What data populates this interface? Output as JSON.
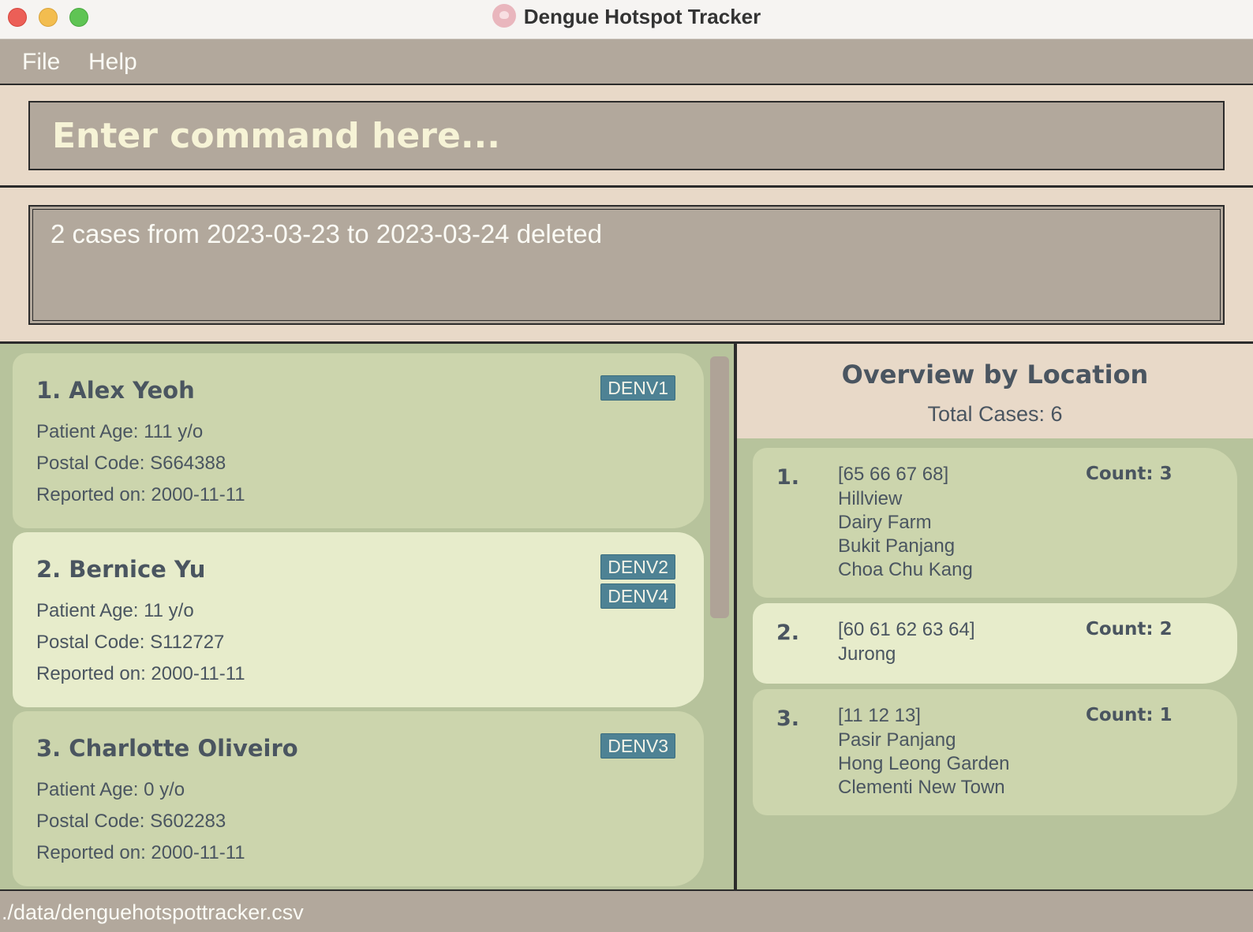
{
  "window": {
    "title": "Dengue Hotspot Tracker",
    "app_icon": "mosquito-icon"
  },
  "menu": {
    "file": "File",
    "help": "Help"
  },
  "command": {
    "placeholder": "Enter command here...",
    "value": ""
  },
  "result": {
    "message": "2 cases from 2023-03-23 to 2023-03-24 deleted"
  },
  "cases": [
    {
      "title": "1. Alex Yeoh",
      "age": "Patient Age: 111 y/o",
      "postal": "Postal Code: S664388",
      "date": "Reported on: 2000-11-11",
      "variants": [
        "DENV1"
      ]
    },
    {
      "title": "2. Bernice Yu",
      "age": "Patient Age: 11 y/o",
      "postal": "Postal Code: S112727",
      "date": "Reported on: 2000-11-11",
      "variants": [
        "DENV2",
        "DENV4"
      ]
    },
    {
      "title": "3. Charlotte Oliveiro",
      "age": "Patient Age: 0 y/o",
      "postal": "Postal Code: S602283",
      "date": "Reported on: 2000-11-11",
      "variants": [
        "DENV3"
      ]
    }
  ],
  "overview": {
    "title": "Overview by Location",
    "total": "Total Cases: 6",
    "locations": [
      {
        "index": "1.",
        "postal": "[65 66 67 68]",
        "names": [
          "Hillview",
          "Dairy Farm",
          "Bukit Panjang",
          "Choa Chu Kang"
        ],
        "count": "Count: 3"
      },
      {
        "index": "2.",
        "postal": "[60 61 62 63 64]",
        "names": [
          "Jurong"
        ],
        "count": "Count: 2"
      },
      {
        "index": "3.",
        "postal": "[11 12 13]",
        "names": [
          "Pasir Panjang",
          "Hong Leong Garden",
          "Clementi New Town"
        ],
        "count": "Count: 1"
      }
    ]
  },
  "status": {
    "file_path": "./data/denguehotspottracker.csv"
  },
  "colors": {
    "accent_tag": "#4e8294",
    "panel_green": "#b7c39c",
    "header_beige": "#e8d9c8",
    "toolbar_taupe": "#b2a89c"
  }
}
